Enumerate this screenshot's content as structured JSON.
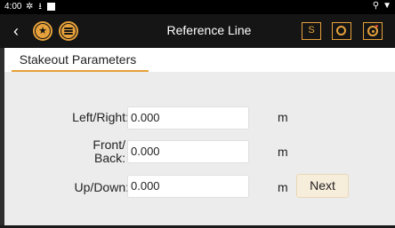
{
  "status_bar": {
    "time": "4:00",
    "left_icons": [
      "settings-icon",
      "download-icon",
      "square-icon"
    ],
    "right_icons": [
      "location-icon",
      "wifi-icon"
    ]
  },
  "header": {
    "title": "Reference Line",
    "back_icon": "chevron-left",
    "buttons": {
      "s_label": "S"
    }
  },
  "tabs": [
    {
      "label": "Stakeout Parameters",
      "active": true
    }
  ],
  "form": {
    "left_right": {
      "label": "Left/Right:",
      "value": "0.000",
      "unit": "m"
    },
    "front_back": {
      "label_line1": "Front/",
      "label_line2": "Back:",
      "value": "0.000",
      "unit": "m"
    },
    "up_down": {
      "label": "Up/Down:",
      "value": "0.000",
      "unit": "m"
    },
    "next_label": "Next"
  },
  "colors": {
    "accent": "#e6a13a",
    "titlebar": "#151515",
    "panel": "#ececec"
  }
}
